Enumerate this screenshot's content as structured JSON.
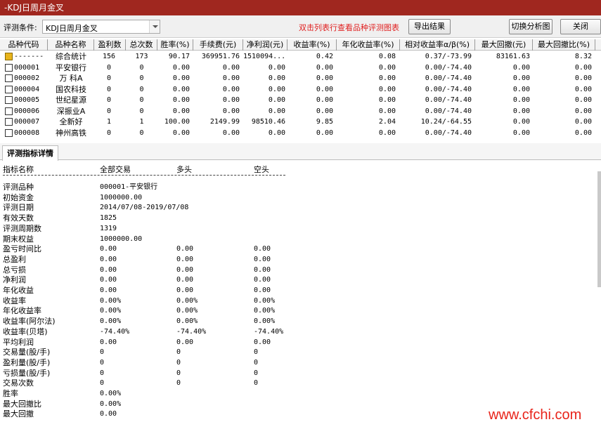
{
  "window": {
    "title": "-KDJ日周月金叉"
  },
  "toolbar": {
    "condition_label": "评测条件:",
    "condition_value": "KDJ日周月金叉",
    "hint": "双击列表行查看品种评测图表",
    "export_label": "导出结果",
    "switch_label": "切换分析图",
    "close_label": "关闭"
  },
  "table": {
    "columns": [
      "品种代码",
      "品种名称",
      "盈利数",
      "总次数",
      "胜率(%)",
      "手续费(元)",
      "净利润(元)",
      "收益率(%)",
      "年化收益率(%)",
      "相对收益率α/β(%)",
      "最大回撤(元)",
      "最大回撤比(%)"
    ],
    "rows": [
      {
        "icon": "summary-icon",
        "code": "-------",
        "name": "综合统计",
        "win": "156",
        "total": "173",
        "rate": "90.17",
        "fee": "369951.76",
        "profit": "1510094...",
        "ret": "0.42",
        "annual": "0.08",
        "rel": "0.37/-73.99",
        "maxdd": "83161.63",
        "ddratio": "8.32"
      },
      {
        "icon": "doc-icon",
        "code": "000001",
        "name": "平安银行",
        "win": "0",
        "total": "0",
        "rate": "0.00",
        "fee": "0.00",
        "profit": "0.00",
        "ret": "0.00",
        "annual": "0.00",
        "rel": "0.00/-74.40",
        "maxdd": "0.00",
        "ddratio": "0.00"
      },
      {
        "icon": "doc-icon",
        "code": "000002",
        "name": "万 科A",
        "win": "0",
        "total": "0",
        "rate": "0.00",
        "fee": "0.00",
        "profit": "0.00",
        "ret": "0.00",
        "annual": "0.00",
        "rel": "0.00/-74.40",
        "maxdd": "0.00",
        "ddratio": "0.00"
      },
      {
        "icon": "doc-icon",
        "code": "000004",
        "name": "国农科技",
        "win": "0",
        "total": "0",
        "rate": "0.00",
        "fee": "0.00",
        "profit": "0.00",
        "ret": "0.00",
        "annual": "0.00",
        "rel": "0.00/-74.40",
        "maxdd": "0.00",
        "ddratio": "0.00"
      },
      {
        "icon": "doc-icon",
        "code": "000005",
        "name": "世纪星源",
        "win": "0",
        "total": "0",
        "rate": "0.00",
        "fee": "0.00",
        "profit": "0.00",
        "ret": "0.00",
        "annual": "0.00",
        "rel": "0.00/-74.40",
        "maxdd": "0.00",
        "ddratio": "0.00"
      },
      {
        "icon": "doc-icon",
        "code": "000006",
        "name": "深振业A",
        "win": "0",
        "total": "0",
        "rate": "0.00",
        "fee": "0.00",
        "profit": "0.00",
        "ret": "0.00",
        "annual": "0.00",
        "rel": "0.00/-74.40",
        "maxdd": "0.00",
        "ddratio": "0.00"
      },
      {
        "icon": "doc-icon",
        "code": "000007",
        "name": "全新好",
        "win": "1",
        "total": "1",
        "rate": "100.00",
        "fee": "2149.99",
        "profit": "98510.46",
        "ret": "9.85",
        "annual": "2.04",
        "rel": "10.24/-64.55",
        "maxdd": "0.00",
        "ddratio": "0.00"
      },
      {
        "icon": "doc-icon",
        "code": "000008",
        "name": "神州高铁",
        "win": "0",
        "total": "0",
        "rate": "0.00",
        "fee": "0.00",
        "profit": "0.00",
        "ret": "0.00",
        "annual": "0.00",
        "rel": "0.00/-74.40",
        "maxdd": "0.00",
        "ddratio": "0.00"
      }
    ]
  },
  "detail": {
    "tab_label": "评测指标详情",
    "head": {
      "name": "指标名称",
      "all": "全部交易",
      "long": "多头",
      "short": "空头"
    },
    "dashes": "----------------------------------------------------------------------",
    "lines": [
      {
        "k": "评测品种",
        "a": "000001-平安银行",
        "b": "",
        "c": ""
      },
      {
        "k": "初始资金",
        "a": "1000000.00",
        "b": "",
        "c": ""
      },
      {
        "k": "评测日期",
        "a": "2014/07/08-2019/07/08",
        "b": "",
        "c": ""
      },
      {
        "k": "有效天数",
        "a": "1825",
        "b": "",
        "c": ""
      },
      {
        "k": "评测周期数",
        "a": "1319",
        "b": "",
        "c": ""
      },
      {
        "k": "期末权益",
        "a": "1000000.00",
        "b": "",
        "c": ""
      },
      {
        "k": "盈亏时间比",
        "a": "0.00",
        "b": "0.00",
        "c": "0.00"
      },
      {
        "k": "总盈利",
        "a": "0.00",
        "b": "0.00",
        "c": "0.00"
      },
      {
        "k": "总亏损",
        "a": "0.00",
        "b": "0.00",
        "c": "0.00"
      },
      {
        "k": "净利润",
        "a": "0.00",
        "b": "0.00",
        "c": "0.00"
      },
      {
        "k": "年化收益",
        "a": "0.00",
        "b": "0.00",
        "c": "0.00"
      },
      {
        "k": "收益率",
        "a": "0.00%",
        "b": "0.00%",
        "c": "0.00%"
      },
      {
        "k": "年化收益率",
        "a": "0.00%",
        "b": "0.00%",
        "c": "0.00%"
      },
      {
        "k": "收益率(阿尔法)",
        "a": "0.00%",
        "b": "0.00%",
        "c": "0.00%"
      },
      {
        "k": "收益率(贝塔)",
        "a": "-74.40%",
        "b": "-74.40%",
        "c": "-74.40%"
      },
      {
        "k": "平均利润",
        "a": "0.00",
        "b": "0.00",
        "c": "0.00"
      },
      {
        "k": "交易量(股/手)",
        "a": "0",
        "b": "0",
        "c": "0"
      },
      {
        "k": "盈利量(股/手)",
        "a": "0",
        "b": "0",
        "c": "0"
      },
      {
        "k": "亏损量(股/手)",
        "a": "0",
        "b": "0",
        "c": "0"
      },
      {
        "k": "交易次数",
        "a": "0",
        "b": "0",
        "c": "0"
      },
      {
        "k": "胜率",
        "a": "0.00%",
        "b": "",
        "c": ""
      },
      {
        "k": "最大回撤比",
        "a": "0.00%",
        "b": "",
        "c": ""
      },
      {
        "k": "最大回撤",
        "a": "0.00",
        "b": "",
        "c": ""
      }
    ]
  },
  "watermark": "www.cfchi.com"
}
